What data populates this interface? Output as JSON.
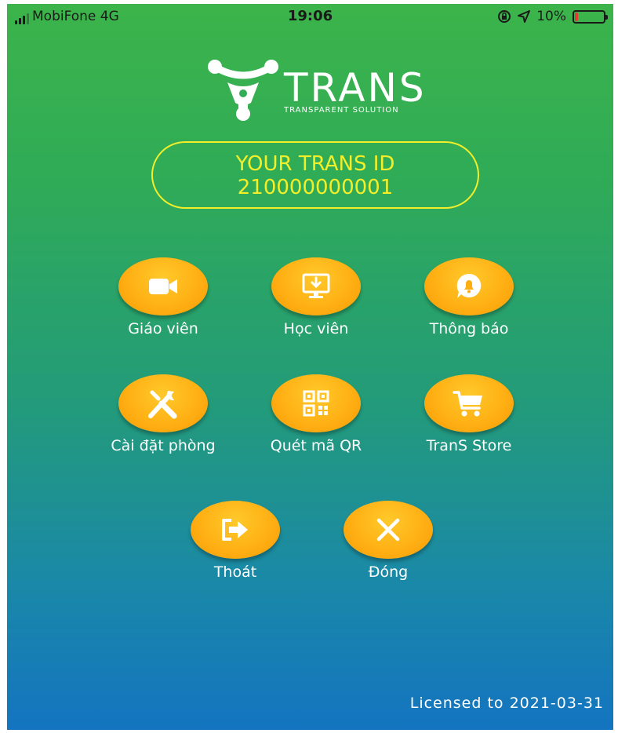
{
  "status": {
    "carrier": "MobiFone  4G",
    "time": "19:06",
    "battery": "10%",
    "battery_level": 0.1
  },
  "logo": {
    "word": "TRANS",
    "tagline": "TRANSPARENT SOLUTION"
  },
  "id_card": {
    "line1": "YOUR TRANS ID",
    "line2": "210000000001"
  },
  "menu": [
    {
      "label": "Giáo viên",
      "icon": "video-camera-icon"
    },
    {
      "label": "Học viên",
      "icon": "monitor-download-icon"
    },
    {
      "label": "Thông báo",
      "icon": "notification-bell-icon"
    },
    {
      "label": "Cài đặt phòng",
      "icon": "tools-icon"
    },
    {
      "label": "Quét mã QR",
      "icon": "qr-code-icon"
    },
    {
      "label": "TranS Store",
      "icon": "shopping-cart-icon"
    },
    {
      "label": "Thoát",
      "icon": "logout-icon"
    },
    {
      "label": "Đóng",
      "icon": "close-icon"
    }
  ],
  "license": "Licensed to 2021-03-31",
  "colors": {
    "accent_yellow": "#f3ee2a",
    "button_orange": "#ffae12",
    "gradient_top": "#3cb44a",
    "gradient_bottom": "#1474c0"
  }
}
